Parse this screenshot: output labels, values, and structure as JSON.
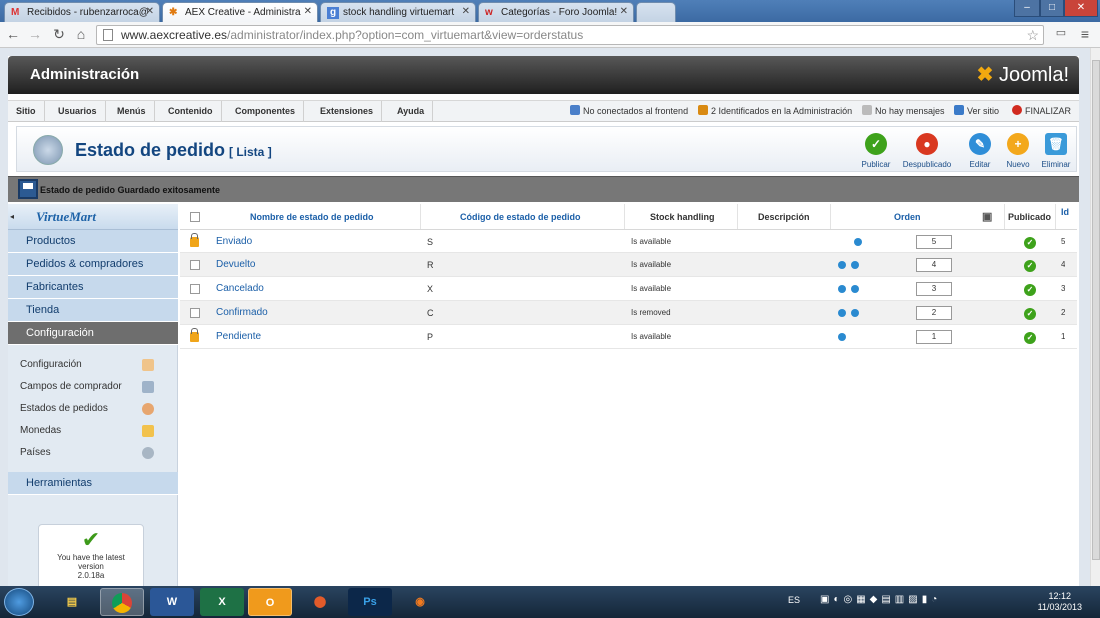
{
  "browser": {
    "tabs": [
      {
        "title": "Recibidos - rubenzarroca@",
        "favicon": "M"
      },
      {
        "title": "AEX Creative - Administra",
        "favicon": "J"
      },
      {
        "title": "stock handling virtuemart",
        "favicon": "g"
      },
      {
        "title": "Categorías - Foro Joomla!",
        "favicon": "w"
      }
    ],
    "url_domain": "www.aexcreative.es",
    "url_path": "/administrator/index.php?option=com_virtuemart&view=orderstatus"
  },
  "admin": {
    "title": "Administración",
    "logo_text": "Joomla!",
    "menu": [
      "Sitio",
      "Usuarios",
      "Menús",
      "Contenido",
      "Componentes",
      "Extensiones",
      "Ayuda"
    ],
    "status": {
      "frontend": "No conectados al frontend",
      "admins": "2 Identificados en la Administración",
      "messages": "No hay mensajes",
      "view_site": "Ver sitio",
      "logout": "FINALIZAR"
    }
  },
  "toolbar": {
    "page_title": "Estado de pedido",
    "page_subtitle": "[ Lista ]",
    "buttons": [
      "Publicar",
      "Despublicado",
      "Editar",
      "Nuevo",
      "Eliminar"
    ]
  },
  "message": "Estado de pedido Guardado exitosamente",
  "sidebar": {
    "logo": "VirtueMart",
    "sections": [
      "Productos",
      "Pedidos & compradores",
      "Fabricantes",
      "Tienda",
      "Configuración"
    ],
    "sub_items": [
      "Configuración",
      "Campos de comprador",
      "Estados de pedidos",
      "Monedas",
      "Países"
    ],
    "tools": "Herramientas",
    "version_line1": "You have the latest",
    "version_line2": "version",
    "version_number": "2.0.18a"
  },
  "table": {
    "headers": {
      "name": "Nombre de estado de pedido",
      "code": "Código de estado de pedido",
      "stock": "Stock handling",
      "desc": "Descripción",
      "order": "Orden",
      "published": "Publicado",
      "id": "Id"
    },
    "rows": [
      {
        "name": "Enviado",
        "code": "S",
        "stock": "Is available",
        "order": "5",
        "id": "5",
        "locked": true
      },
      {
        "name": "Devuelto",
        "code": "R",
        "stock": "Is available",
        "order": "4",
        "id": "4",
        "locked": false
      },
      {
        "name": "Cancelado",
        "code": "X",
        "stock": "Is available",
        "order": "3",
        "id": "3",
        "locked": false
      },
      {
        "name": "Confirmado",
        "code": "C",
        "stock": "Is removed",
        "order": "2",
        "id": "2",
        "locked": false
      },
      {
        "name": "Pendiente",
        "code": "P",
        "stock": "Is available",
        "order": "1",
        "id": "1",
        "locked": true
      }
    ]
  },
  "taskbar": {
    "lang": "ES",
    "time": "12:12",
    "date": "11/03/2013"
  }
}
